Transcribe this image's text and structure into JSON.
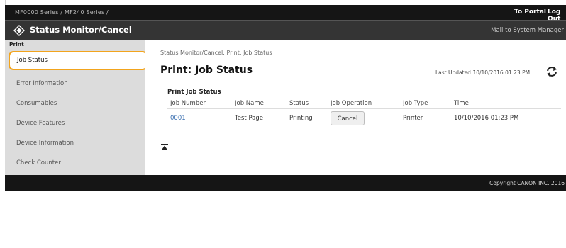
{
  "topbar": {
    "breadcrumb": "MF0000 Series / MF240 Series /",
    "to_portal": "To Portal",
    "log_out": "Log Out"
  },
  "titlebar": {
    "app_title": "Status Monitor/Cancel",
    "mail_link": "Mail to System Manager",
    "logo_icon": "canon-remote-ui-logo-icon"
  },
  "sidebar": {
    "heading": "Print",
    "items": [
      {
        "label": "Job Status",
        "active": true
      },
      {
        "label": "Error Information"
      },
      {
        "label": "Consumables"
      },
      {
        "label": "Device Features"
      },
      {
        "label": "Device Information"
      },
      {
        "label": "Check Counter"
      }
    ]
  },
  "main": {
    "breadcrumb": "Status Monitor/Cancel: Print: Job Status",
    "title": "Print: Job Status",
    "last_updated": "Last Updated:10/10/2016 01:23 PM",
    "refresh_icon": "refresh-icon",
    "section_title": "Print Job Status",
    "columns": [
      "Job Number",
      "Job Name",
      "Status",
      "Job Operation",
      "Job Type",
      "Time"
    ],
    "rows": [
      {
        "job_number": "0001",
        "job_name": "Test Page",
        "status": "Printing",
        "operation": "Cancel",
        "job_type": "Printer",
        "time": "10/10/2016 01:23 PM"
      }
    ],
    "to_top_icon": "scroll-to-top-icon"
  },
  "footer": {
    "copyright": "Copyright CANON INC. 2016"
  },
  "colors": {
    "highlight": "#f2a41d",
    "topbar": "#151515",
    "titlebar": "#343434",
    "sidebar": "#dcdcdc",
    "link": "#3a6fb0"
  }
}
